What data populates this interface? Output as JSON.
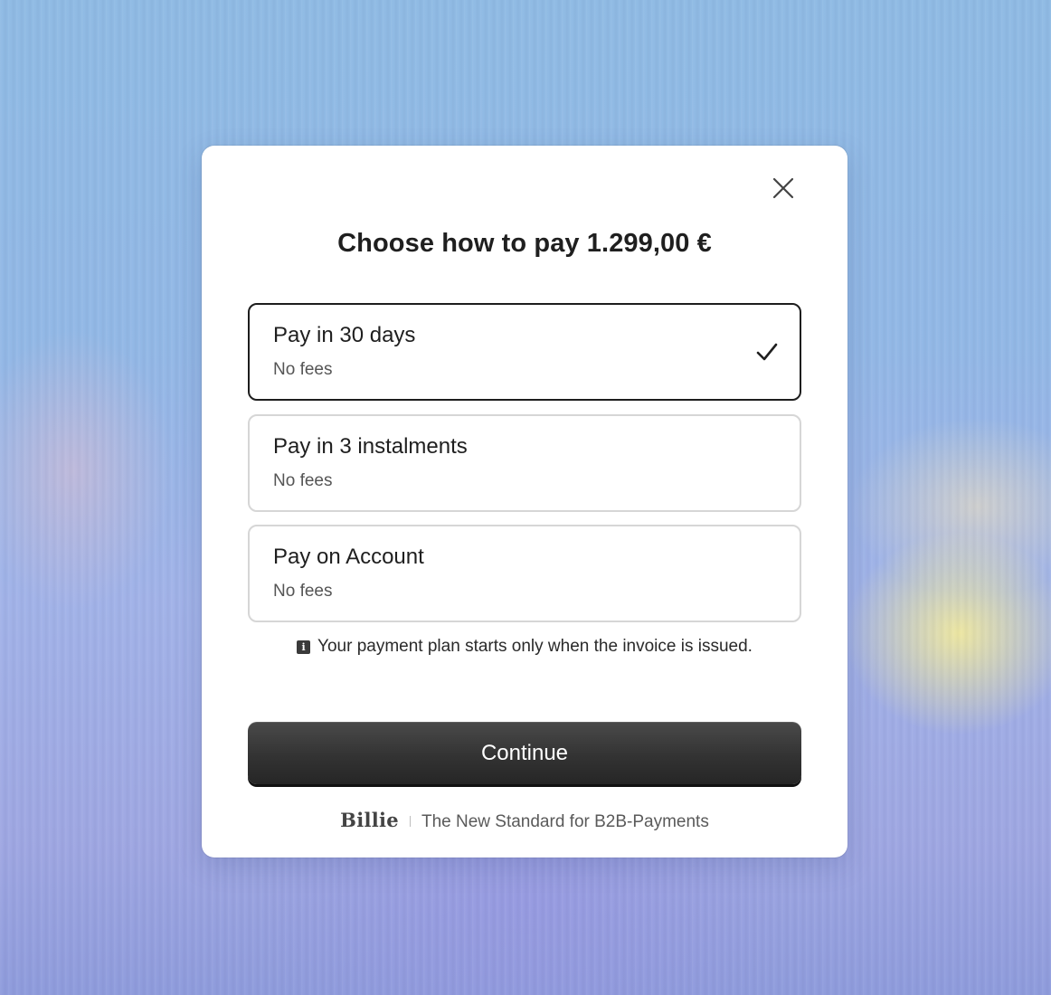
{
  "dialog": {
    "title": "Choose how to pay 1.299,00 €",
    "close_icon": "close-icon",
    "options": [
      {
        "label": "Pay in 30 days",
        "subtitle": "No fees",
        "selected": true
      },
      {
        "label": "Pay in 3 instalments",
        "subtitle": "No fees",
        "selected": false
      },
      {
        "label": "Pay on Account",
        "subtitle": "No fees",
        "selected": false
      }
    ],
    "info_icon": "info-icon",
    "info_text": "Your payment plan starts only when the invoice is issued.",
    "continue_label": "Continue",
    "footer": {
      "brand": "Billie",
      "tagline": "The New Standard for B2B-Payments"
    }
  },
  "colors": {
    "primary_button": "#333333",
    "selected_border": "#1d1d1d",
    "option_border": "#d6d6d6"
  }
}
